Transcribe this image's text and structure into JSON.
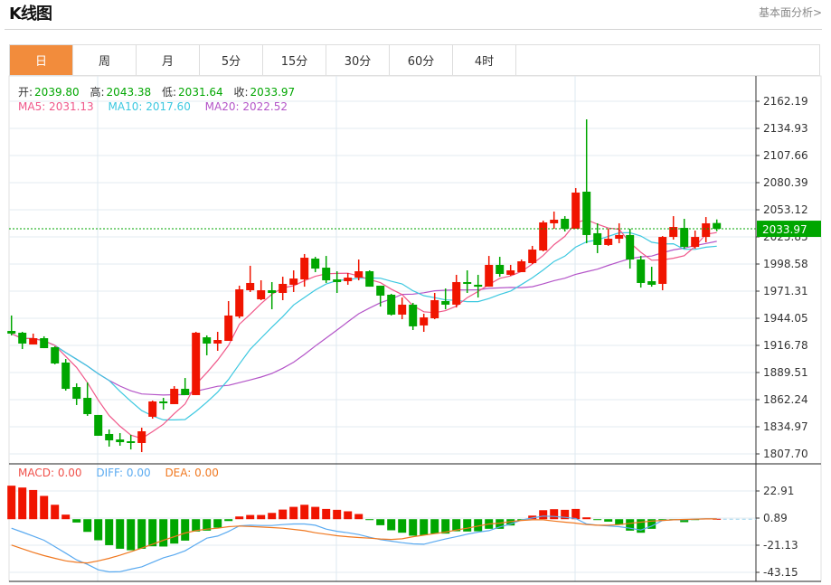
{
  "header": {
    "title": "K线图",
    "link": "基本面分析>"
  },
  "tabs": [
    {
      "label": "日",
      "active": true
    },
    {
      "label": "周"
    },
    {
      "label": "月"
    },
    {
      "label": "5分"
    },
    {
      "label": "15分"
    },
    {
      "label": "30分"
    },
    {
      "label": "60分"
    },
    {
      "label": "4时"
    }
  ],
  "ohlc_legend": {
    "open_label": "开:",
    "open": "2039.80",
    "high_label": "高:",
    "high": "2043.38",
    "low_label": "低:",
    "low": "2031.64",
    "close_label": "收:",
    "close": "2033.97"
  },
  "ma_legend": {
    "ma5": "MA5: 2031.13",
    "ma10": "MA10: 2017.60",
    "ma20": "MA20: 2022.52"
  },
  "macd_legend": {
    "macd": "MACD: 0.00",
    "diff": "DIFF: 0.00",
    "dea": "DEA: 0.00"
  },
  "current_price": "2033.97",
  "colors": {
    "up": "#f01400",
    "down": "#00a600",
    "ma5": "#f0588a",
    "ma10": "#3cc8e0",
    "ma20": "#b455c8",
    "diff": "#5aaaf0",
    "dea": "#f07820",
    "accent": "#f28c3c"
  },
  "chart_data": [
    {
      "type": "candlestick",
      "ylim": [
        1807.7,
        2162.19
      ],
      "y_ticks": [
        "2162.19",
        "2134.93",
        "2107.66",
        "2080.39",
        "2053.12",
        "2025.85",
        "1998.58",
        "1971.31",
        "1944.05",
        "1916.78",
        "1889.51",
        "1862.24",
        "1834.97",
        "1807.70"
      ],
      "grid": true,
      "candles": [
        [
          1931.3,
          1946.8,
          1926.8,
          1928.6
        ],
        [
          1929.5,
          1930.4,
          1913.1,
          1918.6
        ],
        [
          1917.7,
          1928.6,
          1917.7,
          1924.0
        ],
        [
          1924.0,
          1925.9,
          1914.0,
          1914.0
        ],
        [
          1914.9,
          1915.8,
          1897.7,
          1898.6
        ],
        [
          1899.5,
          1903.1,
          1871.3,
          1873.1
        ],
        [
          1874.9,
          1878.6,
          1856.8,
          1863.1
        ],
        [
          1864.0,
          1879.5,
          1845.9,
          1847.7
        ],
        [
          1846.8,
          1846.8,
          1825.9,
          1825.9
        ],
        [
          1827.7,
          1832.2,
          1815.0,
          1821.3
        ],
        [
          1822.2,
          1828.6,
          1815.9,
          1819.5
        ],
        [
          1820.4,
          1826.8,
          1812.2,
          1818.6
        ],
        [
          1818.6,
          1834.0,
          1809.5,
          1830.4
        ],
        [
          1845.0,
          1861.3,
          1843.1,
          1860.4
        ],
        [
          1860.4,
          1864.0,
          1852.2,
          1858.6
        ],
        [
          1857.7,
          1875.8,
          1857.7,
          1873.1
        ],
        [
          1873.1,
          1884.0,
          1866.8,
          1866.8
        ],
        [
          1866.8,
          1930.4,
          1866.8,
          1929.5
        ],
        [
          1924.9,
          1926.8,
          1906.8,
          1918.6
        ],
        [
          1918.6,
          1930.4,
          1911.3,
          1922.2
        ],
        [
          1921.3,
          1961.3,
          1921.3,
          1946.8
        ],
        [
          1945.8,
          1976.8,
          1944.0,
          1973.1
        ],
        [
          1972.2,
          1996.8,
          1970.4,
          1979.5
        ],
        [
          1963.1,
          1982.2,
          1962.2,
          1972.2
        ],
        [
          1972.2,
          1980.4,
          1953.1,
          1969.5
        ],
        [
          1969.5,
          1985.8,
          1962.2,
          1978.6
        ],
        [
          1977.7,
          1992.2,
          1970.4,
          1984.0
        ],
        [
          1983.1,
          2008.6,
          1975.8,
          2004.9
        ],
        [
          2004.0,
          2005.8,
          1990.4,
          1994.0
        ],
        [
          1994.9,
          2006.7,
          1979.5,
          1982.2
        ],
        [
          1983.1,
          1991.3,
          1969.5,
          1980.4
        ],
        [
          1981.3,
          1989.5,
          1977.7,
          1984.9
        ],
        [
          1984.9,
          2003.1,
          1982.2,
          1991.3
        ],
        [
          1991.3,
          1992.2,
          1975.8,
          1975.8
        ],
        [
          1976.8,
          1976.8,
          1955.8,
          1966.8
        ],
        [
          1967.7,
          1968.6,
          1946.8,
          1947.7
        ],
        [
          1947.7,
          1964.9,
          1943.1,
          1957.7
        ],
        [
          1957.7,
          1959.5,
          1932.2,
          1935.9
        ],
        [
          1936.8,
          1948.6,
          1930.4,
          1944.9
        ],
        [
          1944.0,
          1969.5,
          1943.1,
          1962.2
        ],
        [
          1961.3,
          1974.0,
          1953.1,
          1957.7
        ],
        [
          1957.7,
          1987.7,
          1954.9,
          1980.4
        ],
        [
          1980.4,
          1992.2,
          1969.5,
          1978.6
        ],
        [
          1977.7,
          1987.7,
          1964.9,
          1975.8
        ],
        [
          1975.8,
          2006.7,
          1975.8,
          1997.7
        ],
        [
          1997.7,
          2005.8,
          1985.8,
          1988.6
        ],
        [
          1987.7,
          1997.7,
          1986.8,
          1992.2
        ],
        [
          1990.4,
          2003.1,
          1990.4,
          2001.3
        ],
        [
          1999.5,
          2016.8,
          1998.6,
          2013.1
        ],
        [
          2012.2,
          2042.2,
          2011.3,
          2040.4
        ],
        [
          2039.5,
          2051.3,
          2034.0,
          2043.1
        ],
        [
          2044.0,
          2046.7,
          2031.3,
          2034.0
        ],
        [
          2034.0,
          2074.9,
          2034.0,
          2070.4
        ],
        [
          2071.3,
          2144.0,
          2019.5,
          2027.7
        ],
        [
          2029.5,
          2039.5,
          2009.5,
          2017.7
        ],
        [
          2017.7,
          2034.0,
          2016.8,
          2024.0
        ],
        [
          2024.0,
          2039.5,
          2019.5,
          2027.7
        ],
        [
          2027.7,
          2034.0,
          1994.0,
          2003.1
        ],
        [
          2003.1,
          2006.7,
          1974.9,
          1979.5
        ],
        [
          1981.3,
          1995.8,
          1975.8,
          1977.7
        ],
        [
          1978.6,
          2026.7,
          1972.2,
          2025.8
        ],
        [
          2025.8,
          2046.7,
          2023.1,
          2035.8
        ],
        [
          2034.9,
          2044.0,
          2014.0,
          2015.8
        ],
        [
          2015.8,
          2032.2,
          2014.0,
          2025.8
        ],
        [
          2025.8,
          2045.8,
          2020.4,
          2039.5
        ],
        [
          2039.8,
          2043.38,
          2031.64,
          2033.97
        ]
      ],
      "candle_fields": [
        "open",
        "high",
        "low",
        "close"
      ],
      "moving_averages": [
        5,
        10,
        20
      ]
    },
    {
      "type": "macd",
      "ylim": [
        -49,
        51
      ],
      "y_ticks": [
        "22.91",
        "0.89",
        "-21.13",
        "-43.15"
      ],
      "histogram": [
        27.2,
        25.7,
        23.7,
        18.9,
        11.7,
        3.7,
        -2.7,
        -10.3,
        -17.1,
        -21.1,
        -24.0,
        -25.2,
        -24.0,
        -22.0,
        -22.2,
        -19.8,
        -17.4,
        -10.0,
        -9.3,
        -6.9,
        -1.5,
        2.2,
        3.4,
        3.4,
        5.1,
        7.8,
        10.0,
        11.7,
        10.0,
        8.3,
        7.6,
        6.4,
        4.2,
        -0.5,
        -4.9,
        -9.0,
        -11.0,
        -13.4,
        -13.0,
        -11.7,
        -11.7,
        -9.8,
        -10.0,
        -9.8,
        -7.8,
        -7.8,
        -5.1,
        -1.0,
        2.9,
        7.3,
        8.1,
        7.6,
        8.3,
        1.5,
        -0.5,
        -2.0,
        -4.6,
        -9.3,
        -11.0,
        -7.8,
        -0.5,
        -0.5,
        -2.4,
        -0.3,
        0.5,
        0.3
      ],
      "diff": [
        -7.3,
        -10.5,
        -13.7,
        -17.1,
        -22.3,
        -27.6,
        -33.0,
        -36.7,
        -41.1,
        -42.8,
        -42.6,
        -40.6,
        -38.7,
        -35.0,
        -31.3,
        -28.9,
        -25.7,
        -20.5,
        -15.4,
        -13.7,
        -10.0,
        -5.4,
        -4.9,
        -5.1,
        -5.1,
        -4.4,
        -3.9,
        -3.9,
        -4.9,
        -8.1,
        -9.8,
        -11.0,
        -12.5,
        -14.7,
        -16.6,
        -17.8,
        -19.1,
        -20.0,
        -20.3,
        -18.1,
        -16.1,
        -14.2,
        -12.2,
        -10.5,
        -9.3,
        -6.3,
        -3.9,
        -0.7,
        1.0,
        2.5,
        2.2,
        1.5,
        0.5,
        -3.9,
        -4.9,
        -5.4,
        -6.1,
        -7.3,
        -8.8,
        -5.6,
        -1.0,
        -0.5,
        -0.5,
        0.0,
        0.2,
        0.2
      ],
      "dea": [
        -21.0,
        -24.0,
        -26.9,
        -29.6,
        -31.8,
        -33.8,
        -35.0,
        -35.5,
        -33.8,
        -31.8,
        -29.3,
        -26.4,
        -23.5,
        -20.3,
        -17.1,
        -14.2,
        -11.2,
        -9.3,
        -8.1,
        -7.3,
        -6.1,
        -5.6,
        -5.9,
        -6.4,
        -6.8,
        -7.3,
        -8.3,
        -9.3,
        -11.0,
        -12.2,
        -13.4,
        -14.2,
        -14.9,
        -15.4,
        -16.1,
        -16.4,
        -15.9,
        -14.2,
        -13.0,
        -11.7,
        -10.5,
        -8.8,
        -7.3,
        -5.6,
        -3.9,
        -3.2,
        -1.9,
        -1.0,
        -0.5,
        -0.5,
        -1.5,
        -2.4,
        -3.2,
        -4.4,
        -4.9,
        -4.9,
        -4.4,
        -3.4,
        -2.4,
        -1.5,
        -1.0,
        -0.5,
        -0.2,
        0.0,
        0.2,
        0.2
      ]
    }
  ]
}
